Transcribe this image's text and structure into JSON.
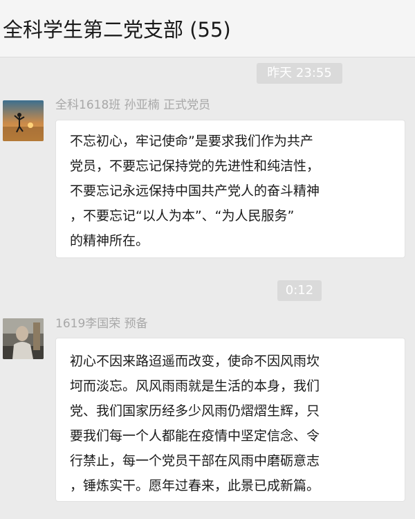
{
  "header": {
    "title": "全科学生第二党支部 (55)"
  },
  "messages": [
    {
      "time": "昨天 23:55",
      "sender": "全科1618班  孙亚楠 正式党员",
      "lines": [
        "不忘初心，牢记使命”是要求我们作为共产",
        "党员，不要忘记保持党的先进性和纯洁性，",
        "不要忘记永远保持中国共产党人的奋斗精神",
        "，不要忘记“以人为本”、“为人民服务”",
        "的精神所在。"
      ],
      "avatar_icon": "sunset-beach-photo-icon"
    },
    {
      "time": "0:12",
      "sender": "1619李国荣 预备",
      "lines": [
        "初心不因来路迢遥而改变，使命不因风雨坎",
        "坷而淡忘。风风雨雨就是生活的本身，我们",
        "党、我们国家历经多少风雨仍熠熠生辉，只",
        "要我们每一个人都能在疫情中坚定信念、令",
        "行禁止，每一个党员干部在风雨中磨砺意志",
        "，锤炼实干。愿年过春来，此景已成新篇。"
      ],
      "avatar_icon": "portrait-photo-icon"
    }
  ],
  "colors": {
    "chat_background": "#ebebeb",
    "header_background": "#f5f5f5",
    "bubble_background": "#ffffff",
    "time_badge_background": "#dadada",
    "sender_text": "#a8a8a8"
  }
}
